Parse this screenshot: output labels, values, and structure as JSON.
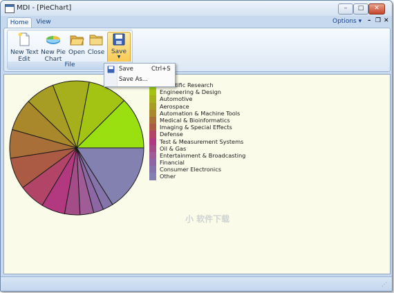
{
  "window": {
    "title": "MDI - [PieChart]",
    "minimize": "–",
    "maximize": "□",
    "close": "✕"
  },
  "tabs": [
    {
      "label": "Home"
    },
    {
      "label": "View"
    }
  ],
  "options": {
    "label": "Options",
    "arrow": "▾"
  },
  "mdi_controls": {
    "minimize": "–",
    "restore": "❐",
    "close": "✕"
  },
  "ribbon": {
    "group_label": "File",
    "buttons": [
      {
        "label": "New Text\nEdit",
        "icon": "new-document-icon"
      },
      {
        "label": "New Pie\nChart",
        "icon": "pie-chart-icon"
      },
      {
        "label": "Open",
        "icon": "open-folder-icon"
      },
      {
        "label": "Close",
        "icon": "close-folder-icon"
      },
      {
        "label": "Save",
        "icon": "floppy-disk-icon"
      }
    ]
  },
  "save_menu": {
    "items": [
      {
        "label": "Save",
        "shortcut": "Ctrl+S",
        "icon": "floppy-disk-icon"
      },
      {
        "label": "Save As...",
        "shortcut": ""
      }
    ]
  },
  "chart_data": {
    "type": "pie",
    "title": "",
    "categories": [
      "Scientific Research",
      "Engineering & Design",
      "Automotive",
      "Aerospace",
      "Automation & Machine Tools",
      "Medical & Bioinformatics",
      "Imaging & Special Effects",
      "Defense",
      "Test & Measurement Systems",
      "Oil & Gas",
      "Entertainment & Broadcasting",
      "Financial",
      "Consumer Electronics",
      "Other"
    ],
    "values": [
      12.5,
      9.5,
      8.8,
      7.0,
      7.8,
      6.9,
      7.6,
      6.3,
      5.7,
      3.7,
      3.3,
      2.4,
      2.5,
      16.0
    ],
    "colors": [
      "#9ae011",
      "#a4c414",
      "#a6b01d",
      "#a79d24",
      "#a9882b",
      "#a86f38",
      "#ab5a44",
      "#b24467",
      "#b23880",
      "#a34c87",
      "#9f5c97",
      "#8c67a3",
      "#8474a9",
      "#8281b0"
    ],
    "legend_position": "right"
  },
  "watermark": "小 软件下载"
}
